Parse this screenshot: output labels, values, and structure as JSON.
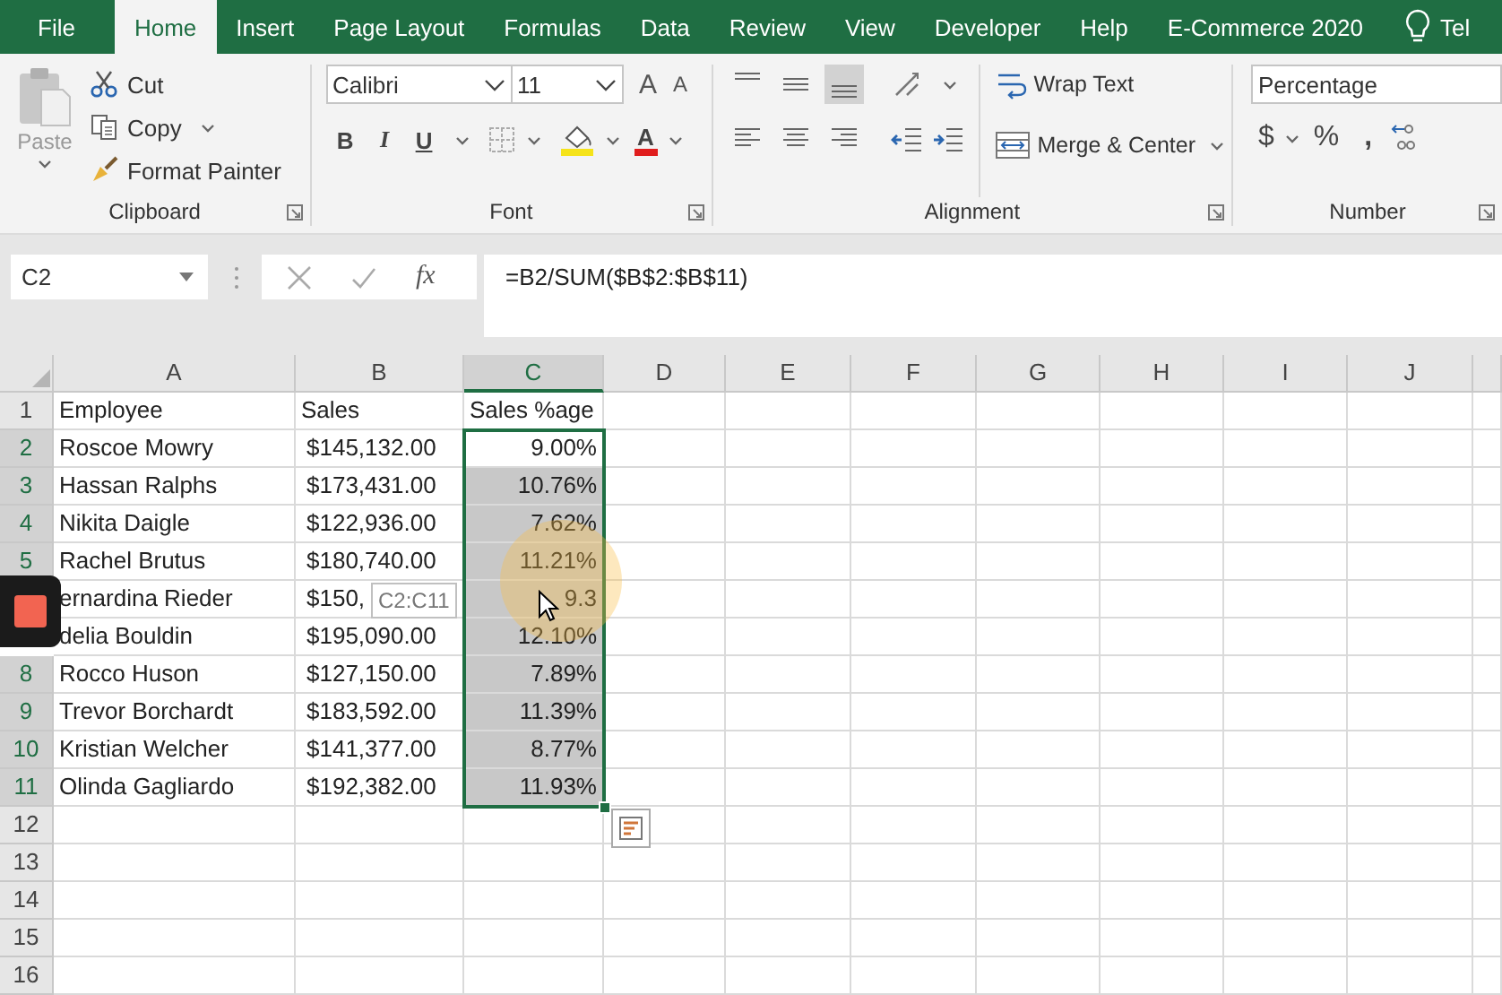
{
  "tabs": [
    {
      "label": "File",
      "selected": false
    },
    {
      "label": "Home",
      "selected": true
    },
    {
      "label": "Insert",
      "selected": false
    },
    {
      "label": "Page Layout",
      "selected": false
    },
    {
      "label": "Formulas",
      "selected": false
    },
    {
      "label": "Data",
      "selected": false
    },
    {
      "label": "Review",
      "selected": false
    },
    {
      "label": "View",
      "selected": false
    },
    {
      "label": "Developer",
      "selected": false
    },
    {
      "label": "Help",
      "selected": false
    },
    {
      "label": "E-Commerce 2020",
      "selected": false
    }
  ],
  "tell_me": "Tel",
  "ribbon": {
    "clipboard": {
      "paste": "Paste",
      "cut": "Cut",
      "copy": "Copy",
      "format_painter": "Format Painter",
      "label": "Clipboard"
    },
    "font": {
      "name": "Calibri",
      "size": "11",
      "grow": "A",
      "shrink": "A",
      "bold": "B",
      "italic": "I",
      "underline": "U",
      "font_color": "A",
      "label": "Font"
    },
    "alignment": {
      "wrap_text": "Wrap Text",
      "merge_center": "Merge & Center",
      "label": "Alignment"
    },
    "number": {
      "format": "Percentage",
      "currency": "$",
      "percent": "%",
      "comma": ",",
      "label": "Number"
    }
  },
  "formula_bar": {
    "name_box": "C2",
    "function_label": "fx",
    "formula": "=B2/SUM($B$2:$B$11)"
  },
  "sheet": {
    "columns": [
      {
        "label": "A",
        "selected": false
      },
      {
        "label": "B",
        "selected": false
      },
      {
        "label": "C",
        "selected": true
      },
      {
        "label": "D",
        "selected": false
      },
      {
        "label": "E",
        "selected": false
      },
      {
        "label": "F",
        "selected": false
      },
      {
        "label": "G",
        "selected": false
      },
      {
        "label": "H",
        "selected": false
      },
      {
        "label": "I",
        "selected": false
      },
      {
        "label": "J",
        "selected": false
      }
    ],
    "rows": [
      {
        "header": "1",
        "kind": "heading",
        "selected": false,
        "cells": [
          "Employee",
          "Sales",
          "Sales %age"
        ]
      },
      {
        "header": "2",
        "kind": "data",
        "selected": true,
        "cells": [
          "Roscoe Mowry",
          "$145,132.00",
          "9.00%"
        ]
      },
      {
        "header": "3",
        "kind": "data",
        "selected": true,
        "cells": [
          "Hassan Ralphs",
          "$173,431.00",
          "10.76%"
        ]
      },
      {
        "header": "4",
        "kind": "data",
        "selected": true,
        "cells": [
          "Nikita Daigle",
          "$122,936.00",
          "7.62%"
        ]
      },
      {
        "header": "5",
        "kind": "data",
        "selected": true,
        "cells": [
          "Rachel Brutus",
          "$180,740.00",
          "11.21%"
        ]
      },
      {
        "kind": "data",
        "selected": true,
        "cells": [
          "ernardina Rieder",
          "$150,",
          "9.3"
        ]
      },
      {
        "kind": "data",
        "selected": true,
        "cells": [
          "delia Bouldin",
          "$195,090.00",
          "12.10%"
        ]
      },
      {
        "header": "8",
        "kind": "data",
        "selected": true,
        "cells": [
          "Rocco Huson",
          "$127,150.00",
          "7.89%"
        ]
      },
      {
        "header": "9",
        "kind": "data",
        "selected": true,
        "cells": [
          "Trevor Borchardt",
          "$183,592.00",
          "11.39%"
        ]
      },
      {
        "header": "10",
        "kind": "data",
        "selected": true,
        "cells": [
          "Kristian Welcher",
          "$141,377.00",
          "8.77%"
        ]
      },
      {
        "header": "11",
        "kind": "data",
        "selected": true,
        "cells": [
          "Olinda Gagliardo",
          "$192,382.00",
          "11.93%"
        ]
      },
      {
        "header": "12",
        "kind": "empty",
        "selected": false
      },
      {
        "header": "13",
        "kind": "empty",
        "selected": false
      },
      {
        "header": "14",
        "kind": "empty",
        "selected": false
      },
      {
        "header": "15",
        "kind": "empty",
        "selected": false
      },
      {
        "header": "16",
        "kind": "empty",
        "selected": false
      }
    ],
    "selection_tooltip": "C2:C11"
  }
}
